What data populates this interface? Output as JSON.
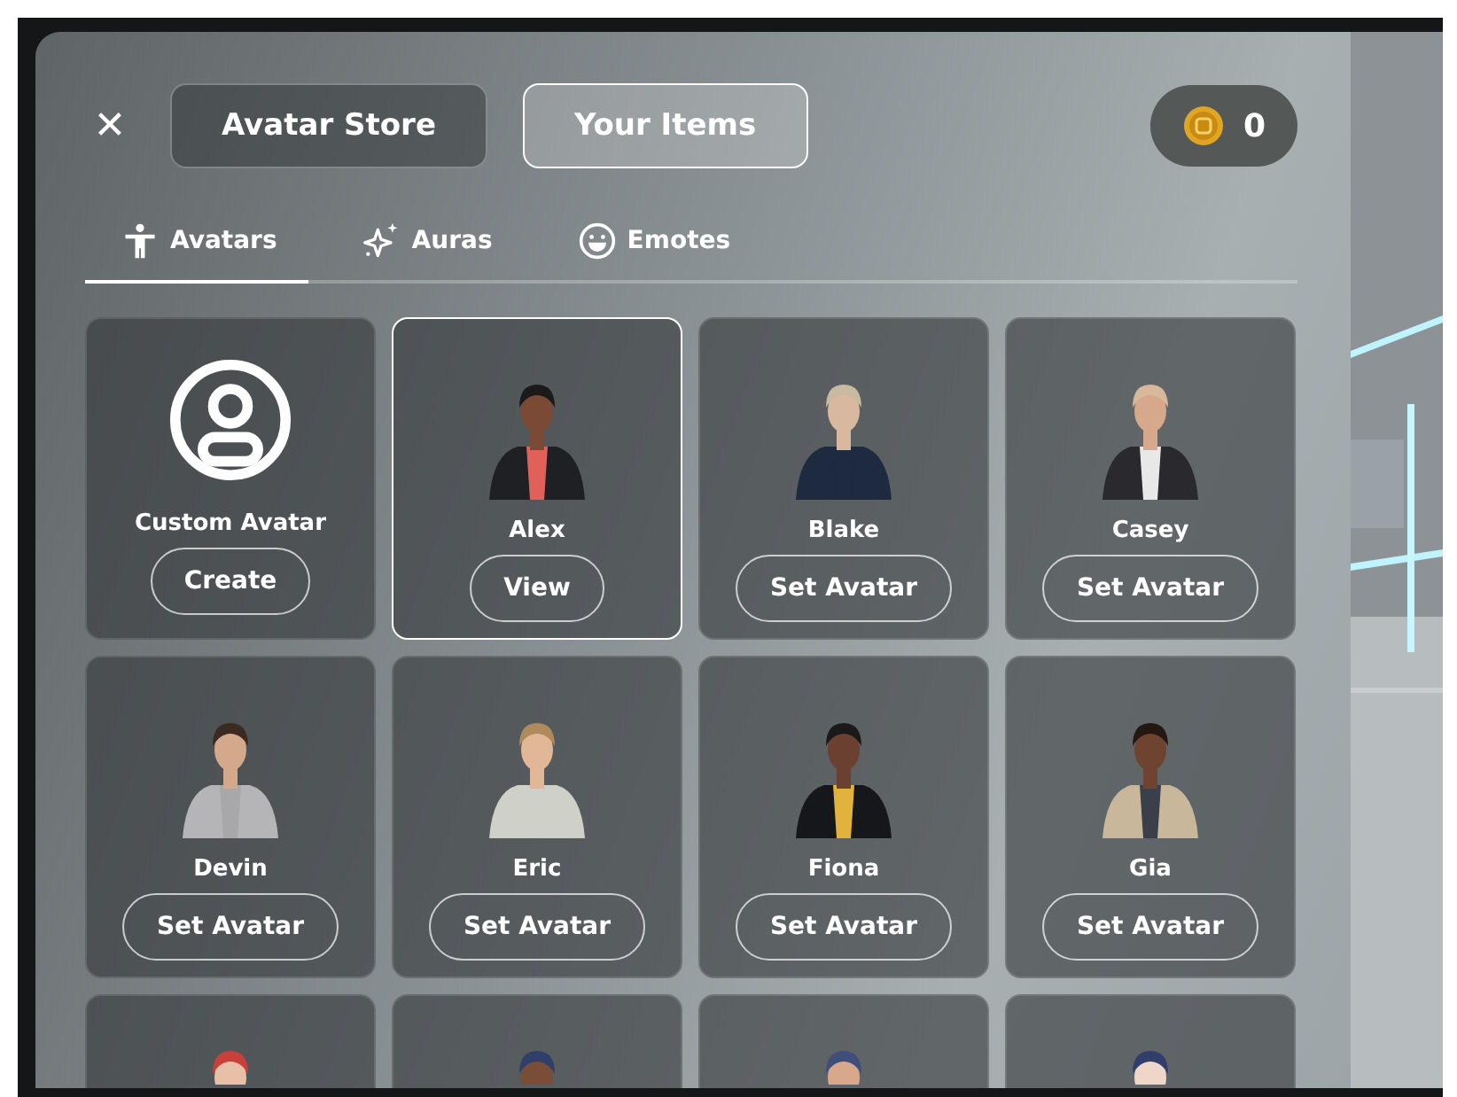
{
  "header": {
    "close": "✕",
    "views": [
      {
        "label": "Avatar Store",
        "selected": false
      },
      {
        "label": "Your Items",
        "selected": true
      }
    ],
    "coins": "0"
  },
  "tabs": [
    {
      "label": "Avatars",
      "kind": "person",
      "selected": true
    },
    {
      "label": "Auras",
      "kind": "sparkle",
      "selected": false
    },
    {
      "label": "Emotes",
      "kind": "smile",
      "selected": false
    }
  ],
  "cards": [
    {
      "kind": "custom",
      "name": "Custom Avatar",
      "action": "Create",
      "selected": false
    },
    {
      "kind": "avatar",
      "name": "Alex",
      "action": "View",
      "selected": true
    },
    {
      "kind": "avatar",
      "name": "Blake",
      "action": "Set Avatar",
      "selected": false
    },
    {
      "kind": "avatar",
      "name": "Casey",
      "action": "Set Avatar",
      "selected": false
    },
    {
      "kind": "avatar",
      "name": "Devin",
      "action": "Set Avatar",
      "selected": false
    },
    {
      "kind": "avatar",
      "name": "Eric",
      "action": "Set Avatar",
      "selected": false
    },
    {
      "kind": "avatar",
      "name": "Fiona",
      "action": "Set Avatar",
      "selected": false
    },
    {
      "kind": "avatar",
      "name": "Gia",
      "action": "Set Avatar",
      "selected": false
    },
    {
      "kind": "peek",
      "selected": false
    },
    {
      "kind": "peek",
      "selected": false
    },
    {
      "kind": "peek",
      "selected": false
    },
    {
      "kind": "peek",
      "selected": false
    }
  ]
}
